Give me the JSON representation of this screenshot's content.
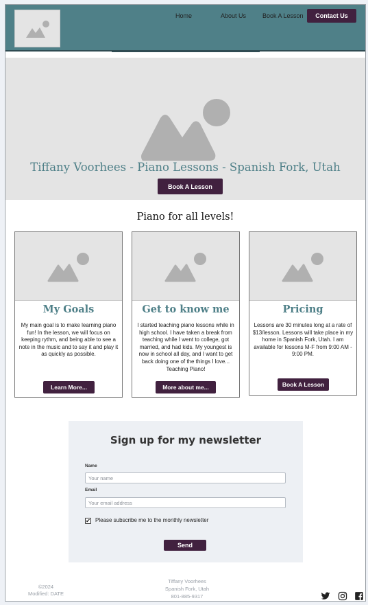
{
  "header": {
    "logo_icon": "image-placeholder-icon",
    "nav": [
      "Home",
      "About Us",
      "Book A Lesson"
    ],
    "contact_label": "Contact Us",
    "colors": {
      "header_bg": "#4f8088",
      "accent": "#41213f"
    }
  },
  "hero": {
    "image_icon": "image-placeholder-icon",
    "title": "Tiffany Voorhees - Piano Lessons - Spanish Fork, Utah",
    "button": "Book A Lesson"
  },
  "section": {
    "title": "Piano for all levels!"
  },
  "cards": [
    {
      "image_icon": "image-placeholder-icon",
      "title": "My Goals",
      "text": "My main goal is to make learning piano fun!  In the lesson, we will focus on keeping rythm, and being able to see a note in the music and to say it and play it as quickly as possible.",
      "button": "Learn More..."
    },
    {
      "image_icon": "image-placeholder-icon",
      "title": "Get to know me",
      "text": "I started teaching piano lessons while in high school.  I have taken a break from teaching while I went to college, got married, and had kids.  My youngest is now in school all day, and I want to get back doing one of the things I love... Teaching Piano!",
      "button": "More about me..."
    },
    {
      "image_icon": "image-placeholder-icon",
      "title": "Pricing",
      "text": "Lessons are 30 minutes long at a rate of $13/lesson. Lessons will take place in my home in Spanish Fork, Utah.  I am available for lessons M-F from 9:00 AM - 9:00 PM.",
      "button": "Book A Lesson"
    }
  ],
  "newsletter": {
    "title": "Sign up for my newsletter",
    "name_label": "Name",
    "name_placeholder": "Your name",
    "email_label": "Email",
    "email_placeholder": "Your email address",
    "subscribe_checked": true,
    "subscribe_label": "Please subscribe me to the monthly newsletter",
    "send": "Send"
  },
  "footer": {
    "copyright": "©2024",
    "modified": "Modified: DATE",
    "name": "Tiffany Voorhees",
    "location": "Spanish Fork, Utah",
    "phone": "801-885-9317",
    "social_icons": [
      "twitter-icon",
      "instagram-icon",
      "facebook-icon"
    ]
  }
}
